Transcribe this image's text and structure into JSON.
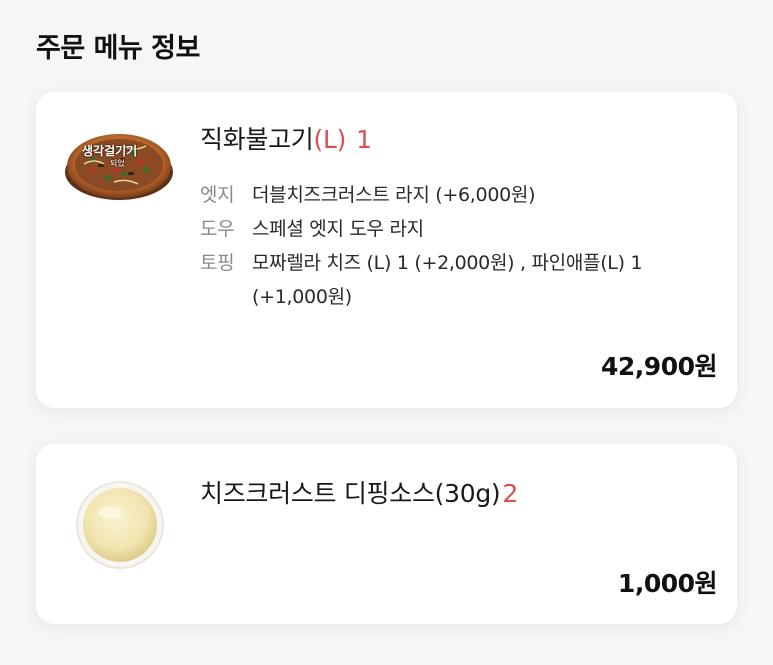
{
  "section": {
    "title": "주문 메뉴 정보"
  },
  "items": [
    {
      "name": "직화불고기",
      "size": "(L)",
      "qty": "1",
      "image_icon": "pizza-image",
      "image_badge": "생각걸기기",
      "image_badge_sub": "되었",
      "options": [
        {
          "label": "엣지",
          "value": "더블치즈크러스트 라지 (+6,000원)"
        },
        {
          "label": "도우",
          "value": "스페셜 엣지 도우 라지"
        },
        {
          "label": "토핑",
          "value": "모짜렐라 치즈 (L) 1 (+2,000원) , 파인애플(L) 1 (+1,000원)"
        }
      ],
      "price": "42,900원"
    },
    {
      "name": "치즈크러스트 디핑소스(30g)",
      "qty": "2",
      "image_icon": "dipping-sauce-image",
      "price": "1,000원"
    }
  ]
}
